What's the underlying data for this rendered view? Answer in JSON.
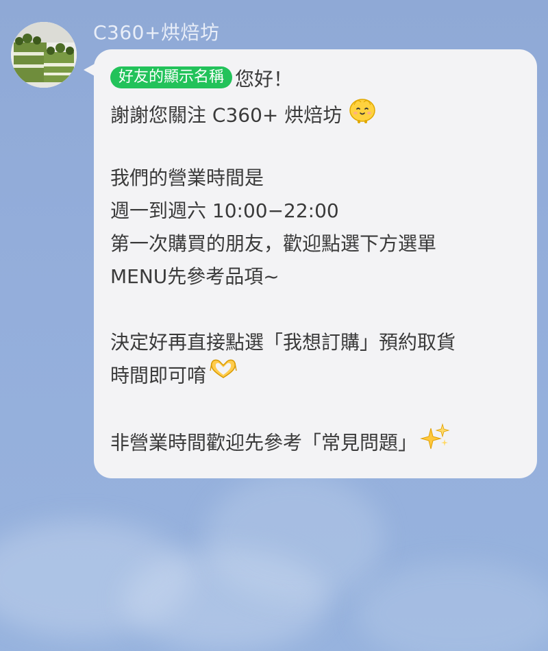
{
  "chat": {
    "sender_name": "C360+烘焙坊",
    "avatar_icon": "matcha-cake-avatar-icon"
  },
  "message": {
    "name_tag": "好友的顯示名稱",
    "greeting": "您好！",
    "line_thanks": "謝謝您關注 C360+ 烘焙坊",
    "line_hours_title": "我們的營業時間是",
    "line_hours": "週一到週六 10:00−22:00",
    "line_first_time": "第一次購買的朋友，歡迎點選下方選單",
    "line_menu": "MENU先參考品項~",
    "line_decide": "決定好再直接點選「我想訂購」預約取貨",
    "line_time": "時間即可唷",
    "line_faq": "非營業時間歡迎先參考「常見問題」",
    "emoji_smile": "smiling-face-emoji-icon",
    "emoji_heart_hands": "heart-hands-emoji-icon",
    "emoji_sparkles": "sparkles-emoji-icon"
  },
  "colors": {
    "background": "#91abd8",
    "bubble": "#f3f3f5",
    "name_tag": "#22c25a",
    "text": "#3a3a3a",
    "sender_name": "#e9eef8"
  }
}
